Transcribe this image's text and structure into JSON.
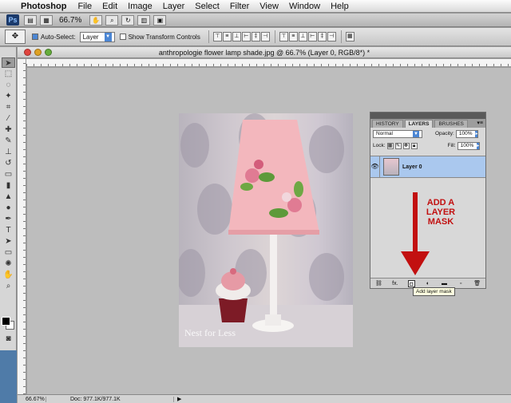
{
  "menubar": {
    "app_name": "Photoshop",
    "items": [
      "File",
      "Edit",
      "Image",
      "Layer",
      "Select",
      "Filter",
      "View",
      "Window",
      "Help"
    ]
  },
  "appbar": {
    "logo": "Ps",
    "zoom": "66.7%"
  },
  "options": {
    "auto_select_label": "Auto-Select:",
    "auto_select_value": "Layer",
    "show_transform_label": "Show Transform Controls"
  },
  "document": {
    "title": "anthropologie flower lamp shade.jpg @ 66.7% (Layer 0, RGB/8*) *",
    "watermark": "Nest for Less",
    "status_zoom": "66.67%",
    "status_doc": "Doc: 977.1K/977.1K"
  },
  "layers_panel": {
    "tabs": [
      "HISTORY",
      "LAYERS",
      "BRUSHES"
    ],
    "active_tab": "LAYERS",
    "blend_mode": "Normal",
    "opacity_label": "Opacity:",
    "opacity_value": "100%",
    "lock_label": "Lock:",
    "fill_label": "Fill:",
    "fill_value": "100%",
    "layer_name": "Layer 0",
    "annotation_lines": [
      "ADD A",
      "LAYER",
      "MASK"
    ],
    "bottom_fx": "fx."
  },
  "tooltip": "Add layer mask",
  "colors": {
    "annotation_red": "#c21010",
    "selected_layer": "#aac8ee"
  }
}
